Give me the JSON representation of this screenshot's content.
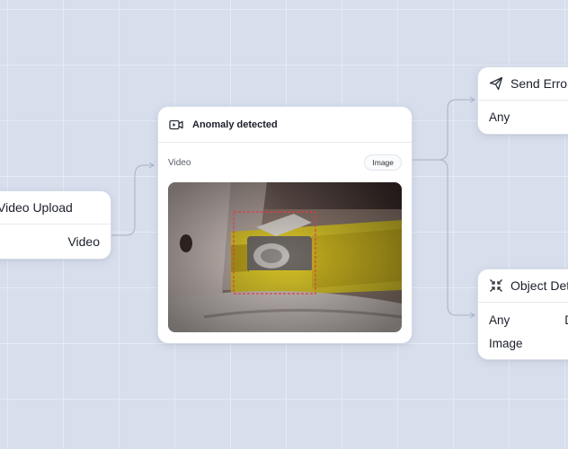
{
  "nodes": {
    "video_upload": {
      "title": "Video Upload",
      "output": "Video"
    },
    "anomaly": {
      "title": "Anomaly detected",
      "input_label": "Video",
      "output_pill": "Image",
      "media_icon": "video-camera-icon"
    },
    "send_error": {
      "title": "Send Error",
      "input": "Any",
      "icon": "paper-plane-icon"
    },
    "object_detection": {
      "title": "Object Detection",
      "input1": "Any",
      "input1_right": "D",
      "input2": "Image",
      "icon": "collapse-arrows-icon"
    }
  },
  "colors": {
    "background": "#d7deec",
    "card": "#ffffff",
    "connector": "#a9b2c3",
    "detection_box": "#e23b4a"
  }
}
